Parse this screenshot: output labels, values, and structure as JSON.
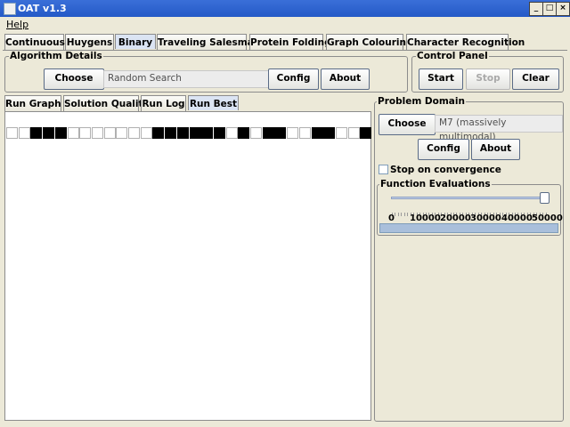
{
  "window": {
    "title": "OAT v1.3"
  },
  "menu": {
    "help": "Help"
  },
  "main_tabs": [
    "Continuous",
    "Huygens",
    "Binary",
    "Traveling Salesman",
    "Protein Folding",
    "Graph Colouring",
    "Character Recognition"
  ],
  "algorithm": {
    "title": "Algorithm Details",
    "choose": "Choose",
    "value": "Random Search",
    "config": "Config",
    "about": "About"
  },
  "control": {
    "title": "Control Panel",
    "start": "Start",
    "stop": "Stop",
    "clear": "Clear"
  },
  "run_tabs": [
    "Run Graph",
    "Solution Quality",
    "Run Log",
    "Run Best"
  ],
  "run_best_bits": [
    0,
    0,
    1,
    1,
    1,
    0,
    0,
    0,
    0,
    0,
    0,
    0,
    1,
    1,
    1,
    1,
    1,
    1,
    0,
    1,
    0,
    1,
    1,
    0,
    0,
    1,
    1,
    0,
    0,
    1
  ],
  "problem": {
    "title": "Problem Domain",
    "choose": "Choose",
    "value": "M7 (massively multimodal)",
    "config": "Config",
    "about": "About",
    "stop_label": "Stop on convergence",
    "stop_checked": false
  },
  "evals": {
    "title": "Function Evaluations",
    "labels": [
      "0",
      "10000",
      "20000",
      "30000",
      "40000",
      "50000"
    ],
    "value": 50000,
    "max": 50000
  }
}
